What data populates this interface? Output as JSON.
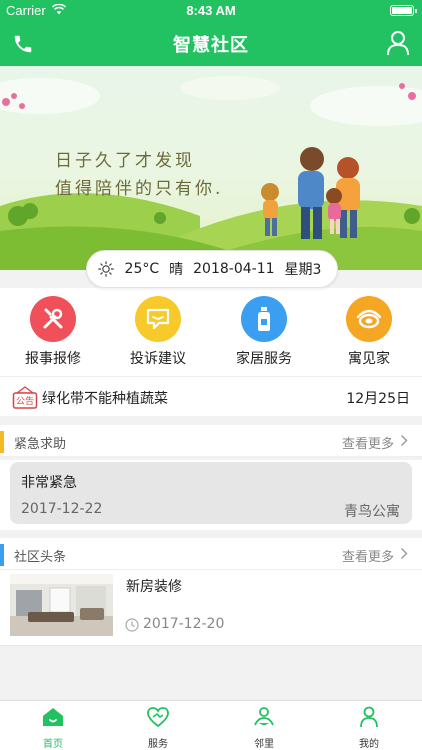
{
  "status_bar": {
    "carrier": "Carrier",
    "time": "8:43 AM"
  },
  "nav": {
    "title": "智慧社区",
    "left_icon": "phone-icon",
    "right_icon": "user-icon"
  },
  "banner": {
    "line1": "日子久了才发现",
    "line2": "值得陪伴的只有你."
  },
  "weather": {
    "icon": "sun-icon",
    "temperature": "25°C",
    "condition": "晴",
    "date": "2018-04-11",
    "weekday": "星期3"
  },
  "quick_actions": [
    {
      "label": "报事报修",
      "icon": "tools-icon",
      "color": "#f0505a"
    },
    {
      "label": "投诉建议",
      "icon": "message-icon",
      "color": "#f8c92a"
    },
    {
      "label": "家居服务",
      "icon": "bottle-icon",
      "color": "#3a9ff0"
    },
    {
      "label": "寓见家",
      "icon": "logo-icon",
      "color": "#f5a623"
    }
  ],
  "notice": {
    "badge": "公告",
    "text": "绿化带不能种植蔬菜",
    "date": "12月25日"
  },
  "emergency": {
    "title": "紧急求助",
    "more": "查看更多",
    "accent": "#f5b921",
    "item": {
      "title": "非常紧急",
      "date": "2017-12-22",
      "place": "青鸟公寓"
    }
  },
  "headlines": {
    "title": "社区头条",
    "more": "查看更多",
    "accent": "#3a9ff0",
    "item": {
      "title": "新房装修",
      "date": "2017-12-20"
    }
  },
  "tabs": [
    {
      "label": "首页",
      "icon": "home-icon",
      "active": true
    },
    {
      "label": "服务",
      "icon": "handshake-icon",
      "active": false
    },
    {
      "label": "邻里",
      "icon": "neighbors-icon",
      "active": false
    },
    {
      "label": "我的",
      "icon": "profile-icon",
      "active": false
    }
  ],
  "colors": {
    "brand": "#22c161",
    "tab_active": "#22c161",
    "tab_inactive": "#333333"
  }
}
